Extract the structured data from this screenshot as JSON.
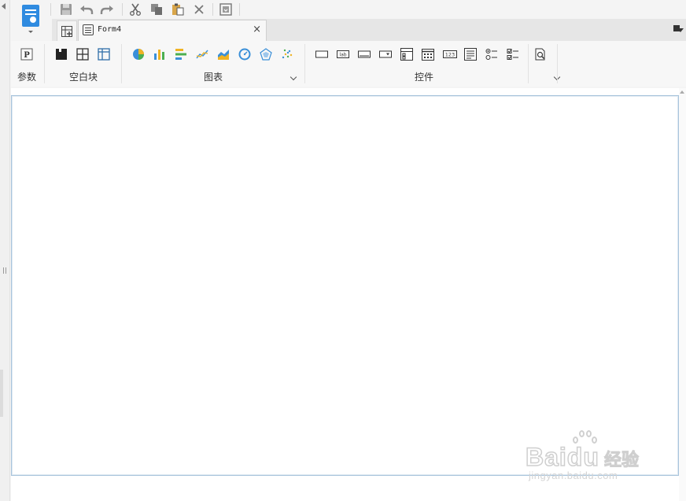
{
  "app": {
    "accent_color": "#2f8be0"
  },
  "toolbar": {
    "buttons": [
      {
        "name": "save-icon",
        "glyph": "▆"
      },
      {
        "name": "undo-icon",
        "glyph": "↶"
      },
      {
        "name": "redo-icon",
        "glyph": "↷"
      },
      {
        "name": "cut-icon",
        "glyph": "✂"
      },
      {
        "name": "copy-icon",
        "glyph": "❐"
      },
      {
        "name": "paste-icon",
        "glyph": "📋"
      },
      {
        "name": "delete-icon",
        "glyph": "✕"
      },
      {
        "name": "template-save-icon",
        "glyph": "⊡"
      }
    ]
  },
  "tabs": {
    "active_tab_label": "Form4",
    "close_glyph": "×"
  },
  "ribbon": {
    "groups": {
      "params": {
        "label": "参数",
        "icon": "param-p-icon"
      },
      "blank_block": {
        "label": "空白块",
        "icons": [
          "absolute-layout-icon",
          "split-layout-icon",
          "tab-layout-icon"
        ]
      },
      "charts": {
        "label": "图表",
        "icons": [
          "pie-chart-icon",
          "bar-chart-icon",
          "horizontal-bar-chart-icon",
          "line-chart-icon",
          "area-chart-icon",
          "gauge-chart-icon",
          "radar-chart-icon",
          "scatter-chart-icon"
        ]
      },
      "controls": {
        "label": "控件",
        "icons": [
          "button-widget-icon",
          "label-widget-icon",
          "textbox-widget-icon",
          "dropdown-widget-icon",
          "dropdown-tree-widget-icon",
          "date-widget-icon",
          "number-widget-icon",
          "textarea-widget-icon",
          "radio-group-widget-icon",
          "checkbox-group-widget-icon",
          "query-button-icon"
        ]
      }
    }
  },
  "watermark": {
    "brand": "Baidu",
    "brand_cn": "经验",
    "url": "jingyan.baidu.com"
  }
}
